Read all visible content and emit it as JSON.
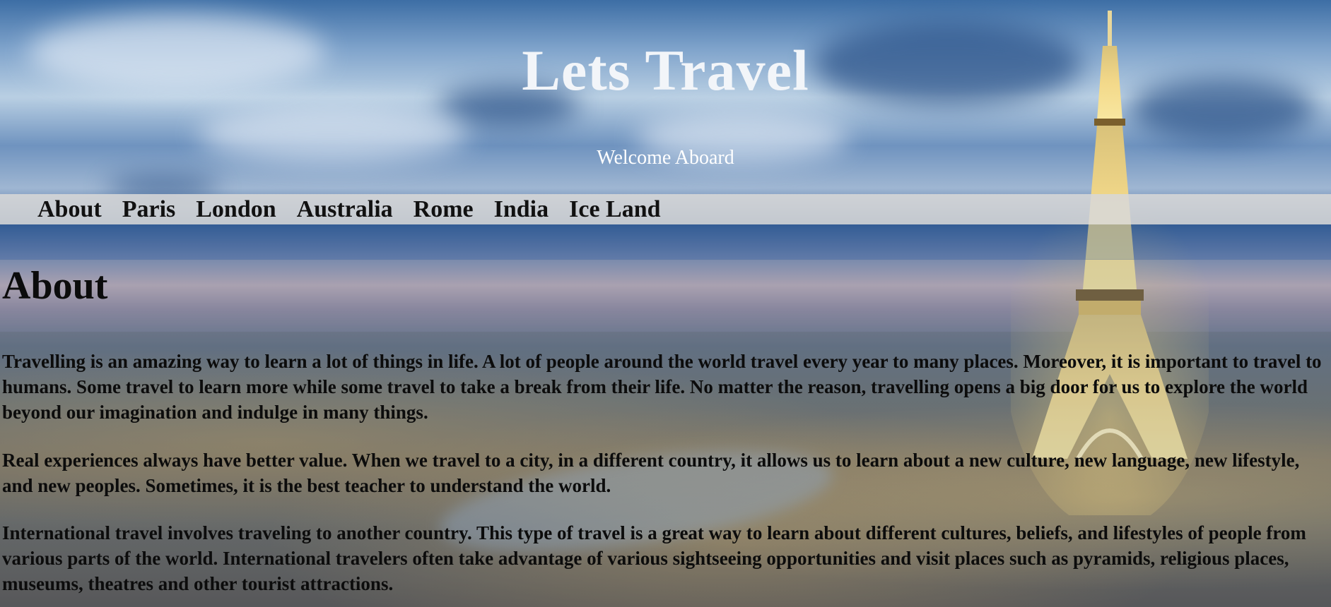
{
  "header": {
    "title": "Lets Travel",
    "subtitle": "Welcome Aboard"
  },
  "nav": {
    "items": [
      "About",
      "Paris",
      "London",
      "Australia",
      "Rome",
      "India",
      "Ice Land"
    ]
  },
  "about": {
    "heading": "About",
    "paragraphs": [
      "Travelling is an amazing way to learn a lot of things in life. A lot of people around the world travel every year to many places. Moreover, it is important to travel to humans. Some travel to learn more while some travel to take a break from their life. No matter the reason, travelling opens a big door for us to explore the world beyond our imagination and indulge in many things.",
      "Real experiences always have better value. When we travel to a city, in a different country, it allows us to learn about a new culture, new language, new lifestyle, and new peoples. Sometimes, it is the best teacher to understand the world.",
      "International travel involves traveling to another country. This type of travel is a great way to learn about different cultures, beliefs, and lifestyles of people from various parts of the world. International travelers often take advantage of various sightseeing opportunities and visit places such as pyramids, religious places, museums, theatres and other tourist attractions."
    ]
  },
  "colors": {
    "title_text": "#f2f5f9",
    "nav_background": "#d7d7d7",
    "body_text": "#0c0c0c"
  }
}
